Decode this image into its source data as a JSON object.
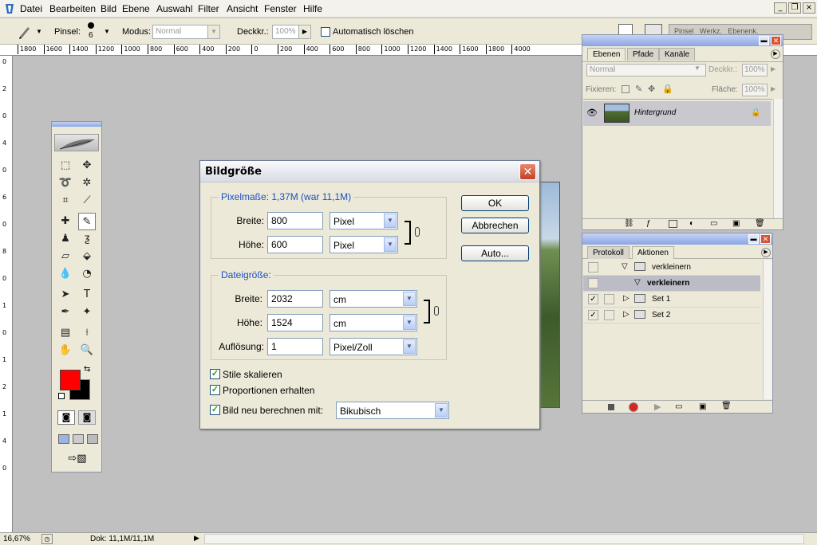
{
  "menubar": {
    "items": [
      "Datei",
      "Bearbeiten",
      "Bild",
      "Ebene",
      "Auswahl",
      "Filter",
      "Ansicht",
      "Fenster",
      "Hilfe"
    ],
    "window_controls": [
      "_",
      "❐",
      "×"
    ]
  },
  "options_bar": {
    "brush_label": "Pinsel:",
    "brush_size": "6",
    "mode_label": "Modus:",
    "mode_value": "Normal",
    "opacity_label": "Deckkr.:",
    "opacity_value": "100%",
    "auto_erase_label": "Automatisch löschen",
    "auto_erase_checked": false
  },
  "ruler_top": [
    "1800",
    "1600",
    "1400",
    "1200",
    "1000",
    "800",
    "600",
    "400",
    "200",
    "0",
    "200",
    "400",
    "600",
    "800",
    "1000",
    "1200",
    "1400",
    "1600",
    "1800",
    "4000"
  ],
  "ruler_left": [
    "0",
    "2",
    "0",
    "4",
    "0",
    "6",
    "0",
    "8",
    "0",
    "1",
    "0",
    "1",
    "2",
    "1",
    "4",
    "0"
  ],
  "status_bar": {
    "zoom": "16,67%",
    "doc_info": "Dok: 11,1M/11,1M"
  },
  "toolbox": {
    "foreground_color": "#ff0000",
    "background_color": "#000000"
  },
  "dialog": {
    "title": "Bildgröße",
    "pixel_section": {
      "legend": "Pixelmaße: 1,37M (war 11,1M)",
      "width_label": "Breite:",
      "width_value": "800",
      "width_unit": "Pixel",
      "height_label": "Höhe:",
      "height_value": "600",
      "height_unit": "Pixel"
    },
    "doc_section": {
      "legend": "Dateigröße:",
      "width_label": "Breite:",
      "width_value": "2032",
      "width_unit": "cm",
      "height_label": "Höhe:",
      "height_value": "1524",
      "height_unit": "cm",
      "resolution_label": "Auflösung:",
      "resolution_value": "1",
      "resolution_unit": "Pixel/Zoll"
    },
    "scale_styles": {
      "label": "Stile skalieren",
      "checked": true
    },
    "constrain": {
      "label": "Proportionen erhalten",
      "checked": true
    },
    "resample": {
      "label": "Bild neu berechnen mit:",
      "checked": true,
      "method": "Bikubisch"
    },
    "buttons": {
      "ok": "OK",
      "cancel": "Abbrechen",
      "auto": "Auto..."
    }
  },
  "layers_palette": {
    "tabs": [
      "Ebenen",
      "Pfade",
      "Kanäle"
    ],
    "blend_mode": "Normal",
    "opacity_label": "Deckkr.:",
    "opacity_value": "100%",
    "lock_label": "Fixieren:",
    "fill_label": "Fläche:",
    "fill_value": "100%",
    "layer_name": "Hintergrund"
  },
  "actions_palette": {
    "tabs": [
      "Protokoll",
      "Aktionen"
    ],
    "rows": [
      {
        "name": "verkleinern",
        "checked": false,
        "kind": "set"
      },
      {
        "name": "verkleinern",
        "checked": false,
        "kind": "action"
      },
      {
        "name": "Set 1",
        "checked": true,
        "kind": "set"
      },
      {
        "name": "Set 2",
        "checked": true,
        "kind": "set"
      }
    ]
  },
  "right_top_tabs": [
    "Pinsel",
    "Werkz.",
    "Ebenenk."
  ]
}
